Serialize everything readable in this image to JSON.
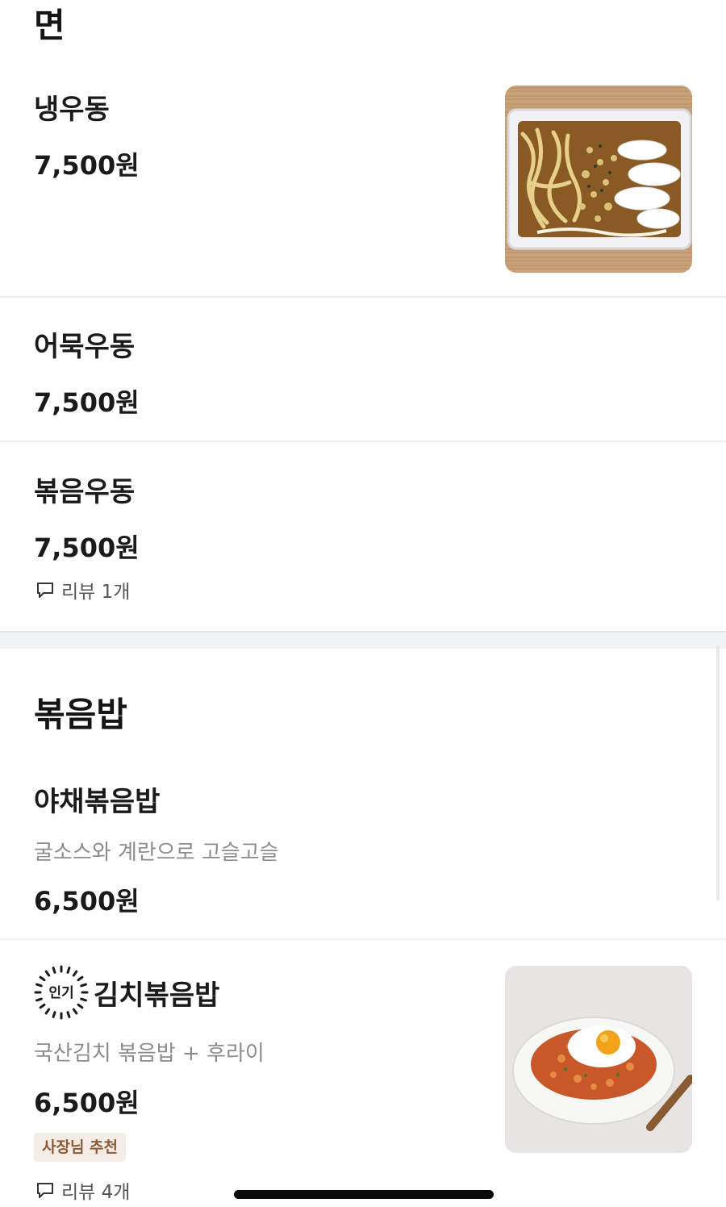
{
  "sections": [
    {
      "title": "면",
      "items": [
        {
          "name": "냉우동",
          "price": "7,500원",
          "image": "cold-udon-photo"
        },
        {
          "name": "어묵우동",
          "price": "7,500원"
        },
        {
          "name": "볶음우동",
          "price": "7,500원",
          "review": "리뷰 1개"
        }
      ]
    },
    {
      "title": "볶음밥",
      "items": [
        {
          "name": "야채볶음밥",
          "description": "굴소스와 계란으로 고슬고슬",
          "price": "6,500원"
        },
        {
          "name": "김치볶음밥",
          "badge": "인기",
          "description": "국산김치 볶음밥 + 후라이",
          "price": "6,500원",
          "tag": "사장님 추천",
          "review": "리뷰 4개",
          "image": "kimchi-fried-rice-photo"
        }
      ]
    }
  ],
  "colors": {
    "text_primary": "#1a1a1a",
    "text_secondary": "#8c8c8c",
    "tag_background": "#f4ede6",
    "tag_text": "#8b5a37"
  },
  "icons": [
    "speech-bubble-icon",
    "popular-badge-icon"
  ]
}
